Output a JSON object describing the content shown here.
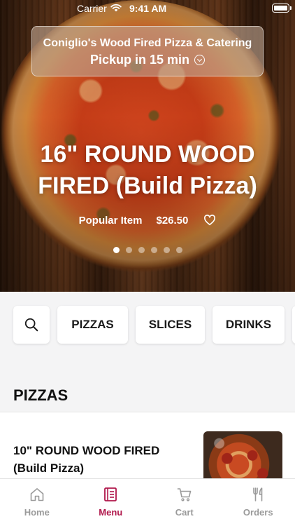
{
  "status_bar": {
    "carrier": "Carrier",
    "time": "9:41 AM"
  },
  "store": {
    "name": "Coniglio's Wood Fired Pizza & Catering",
    "pickup": "Pickup in 15 min"
  },
  "featured": {
    "title_line1": "16\" ROUND WOOD",
    "title_line2": "FIRED (Build Pizza)",
    "badge": "Popular Item",
    "price": "$26.50",
    "carousel_pages": 6,
    "active_page": 1
  },
  "categories": [
    "PIZZAS",
    "SLICES",
    "DRINKS"
  ],
  "section": {
    "title": "PIZZAS"
  },
  "menu_items": [
    {
      "name_line1": "10\" ROUND WOOD FIRED",
      "name_line2": "(Build Pizza)"
    }
  ],
  "tabs": [
    {
      "label": "Home",
      "icon": "home-icon",
      "active": false
    },
    {
      "label": "Menu",
      "icon": "menu-icon",
      "active": true
    },
    {
      "label": "Cart",
      "icon": "cart-icon",
      "active": false
    },
    {
      "label": "Orders",
      "icon": "fork-knife-icon",
      "active": false
    }
  ],
  "colors": {
    "accent": "#b0174b",
    "tab_inactive": "#9a9a9a",
    "background": "#f4f4f5"
  }
}
